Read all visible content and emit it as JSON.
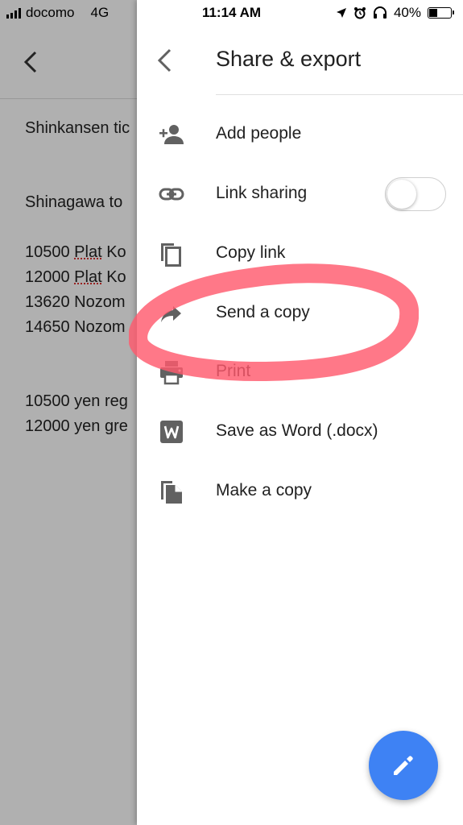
{
  "status_bar": {
    "carrier": "docomo",
    "network": "4G",
    "time": "11:14 AM",
    "battery_percent": "40%",
    "battery_level": 0.4
  },
  "document": {
    "lines": [
      {
        "text": "Shinkansen tic"
      },
      {
        "text": "Shinagawa to"
      },
      {
        "prefix": "10500 ",
        "underlined": "Plat",
        "suffix": " Ko"
      },
      {
        "prefix": "12000 ",
        "underlined": "Plat",
        "suffix": " Ko"
      },
      {
        "text": "13620 Nozom"
      },
      {
        "text": "14650 Nozom"
      },
      {
        "text": "10500 yen reg"
      },
      {
        "text": "12000 yen gre"
      }
    ]
  },
  "drawer": {
    "title": "Share & export",
    "items": [
      {
        "label": "Add people",
        "icon": "add-person-icon"
      },
      {
        "label": "Link sharing",
        "icon": "link-icon",
        "toggle_on": false
      },
      {
        "label": "Copy link",
        "icon": "copy-icon"
      },
      {
        "label": "Send a copy",
        "icon": "share-arrow-icon"
      },
      {
        "label": "Print",
        "icon": "printer-icon"
      },
      {
        "label": "Save as Word (.docx)",
        "icon": "word-icon"
      },
      {
        "label": "Make a copy",
        "icon": "file-copy-icon"
      }
    ]
  },
  "colors": {
    "fab": "#3e82f4",
    "highlight_marker": "#ff5a6e",
    "icon_gray": "#616161"
  }
}
